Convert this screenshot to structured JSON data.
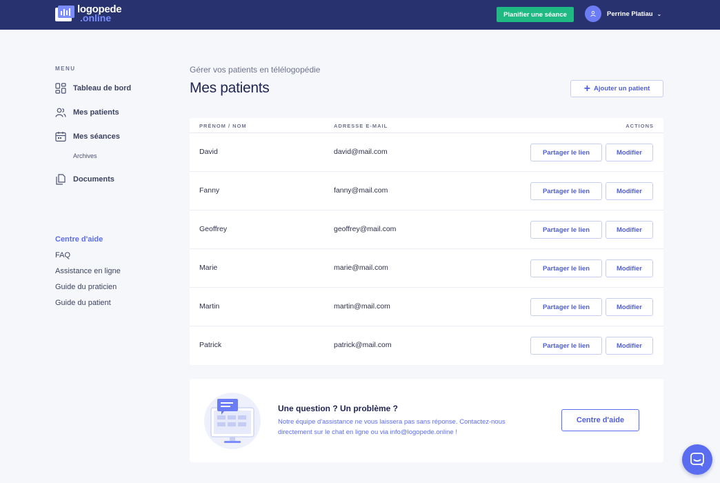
{
  "brand": {
    "name_line1": "logopede",
    "name_line2": ".online"
  },
  "header": {
    "plan_button": "Planifier une séance",
    "user_name": "Perrine Platiau"
  },
  "sidebar": {
    "menu_label": "MENU",
    "items": [
      {
        "label": "Tableau de bord",
        "icon": "grid-icon"
      },
      {
        "label": "Mes patients",
        "icon": "users-icon"
      },
      {
        "label": "Mes séances",
        "icon": "calendar-icon"
      },
      {
        "label": "Documents",
        "icon": "documents-icon"
      }
    ],
    "sub_item": "Archives",
    "help_title": "Centre d'aide",
    "help_links": [
      "FAQ",
      "Assistance en ligne",
      "Guide du praticien",
      "Guide du patient"
    ]
  },
  "main": {
    "subtitle": "Gérer vos patients en télélogopédie",
    "title": "Mes patients",
    "add_button": "Ajouter un patient",
    "columns": {
      "name": "PRÉNOM / NOM",
      "email": "ADRESSE E-MAIL",
      "actions": "ACTIONS"
    },
    "share_label": "Partager le lien",
    "edit_label": "Modifier",
    "patients": [
      {
        "name": "David",
        "email": "david@mail.com"
      },
      {
        "name": "Fanny",
        "email": "fanny@mail.com"
      },
      {
        "name": "Geoffrey",
        "email": "geoffrey@mail.com"
      },
      {
        "name": "Marie",
        "email": "marie@mail.com"
      },
      {
        "name": "Martin",
        "email": "martin@mail.com"
      },
      {
        "name": "Patrick",
        "email": "patrick@mail.com"
      }
    ]
  },
  "help_card": {
    "title": "Une question ? Un problème ?",
    "description": "Notre équipe d'assistance ne vous laissera pas sans réponse. Contactez-nous directement sur le chat en ligne ou via info@logopede.online !",
    "button": "Centre d'aide"
  },
  "colors": {
    "header_bg": "#27326e",
    "accent": "#5a6cf0",
    "green": "#1fb983"
  }
}
